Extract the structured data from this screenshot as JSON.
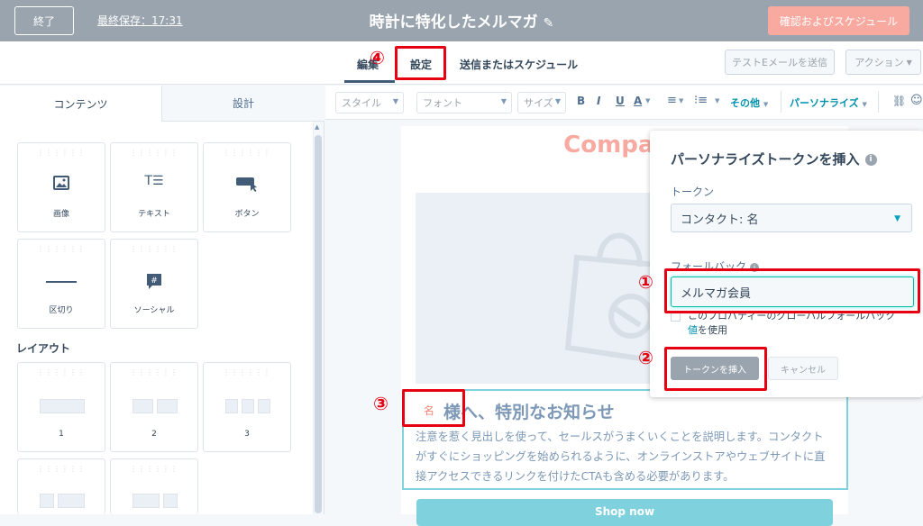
{
  "topbar": {
    "exit_label": "終了",
    "last_saved": "最終保存：17:31",
    "email_title": "時計に特化したメルマガ",
    "review_label": "確認およびスケジュール"
  },
  "tabs": {
    "edit": "編集",
    "settings": "設定",
    "send": "送信またはスケジュール",
    "test_email": "テストEメールを送信",
    "actions": "アクション"
  },
  "left_panel": {
    "tab_contents": "コンテンツ",
    "tab_design": "設計",
    "content_tiles": [
      {
        "label": "画像",
        "icon": "image-icon"
      },
      {
        "label": "テキスト",
        "icon": "text-icon"
      },
      {
        "label": "ボタン",
        "icon": "button-icon"
      },
      {
        "label": "区切り",
        "icon": "divider-icon"
      },
      {
        "label": "ソーシャル",
        "icon": "social-icon"
      }
    ],
    "layout_heading": "レイアウト",
    "layout_tiles": [
      {
        "label": "1"
      },
      {
        "label": "2"
      },
      {
        "label": "3"
      }
    ]
  },
  "toolbar": {
    "style": "スタイル",
    "font": "フォント",
    "size": "サイズ",
    "bold": "B",
    "italic": "I",
    "underline": "U",
    "color": "A",
    "other": "その他",
    "personalize": "パーソナライズ"
  },
  "email": {
    "company": "Company",
    "token_chip": "名",
    "heading": "様へ、特別なお知らせ",
    "body_lines": [
      "注意を惹く見出しを使って、セールスがうまくいくことを説明します。コンタクト",
      "がすぐにショッピングを始められるように、オンラインストアやウェブサイトに直",
      "接アクセスできるリンクを付けたCTAも含める必要があります。"
    ],
    "shop_button": "Shop now"
  },
  "popover": {
    "title": "パーソナライズトークンを挿入",
    "token_label": "トークン",
    "token_value": "コンタクト: 名",
    "fallback_label": "フォールバック",
    "fallback_value": "メルマガ会員",
    "global_text": "このプロパティーのグローバルフォールバック",
    "global_link": "値",
    "global_suffix": "を使用",
    "insert_label": "トークンを挿入",
    "cancel_label": "キャンセル"
  },
  "annotations": {
    "n1": "①",
    "n2": "②",
    "n3": "③",
    "n4": "④",
    "color": "#e60012"
  }
}
